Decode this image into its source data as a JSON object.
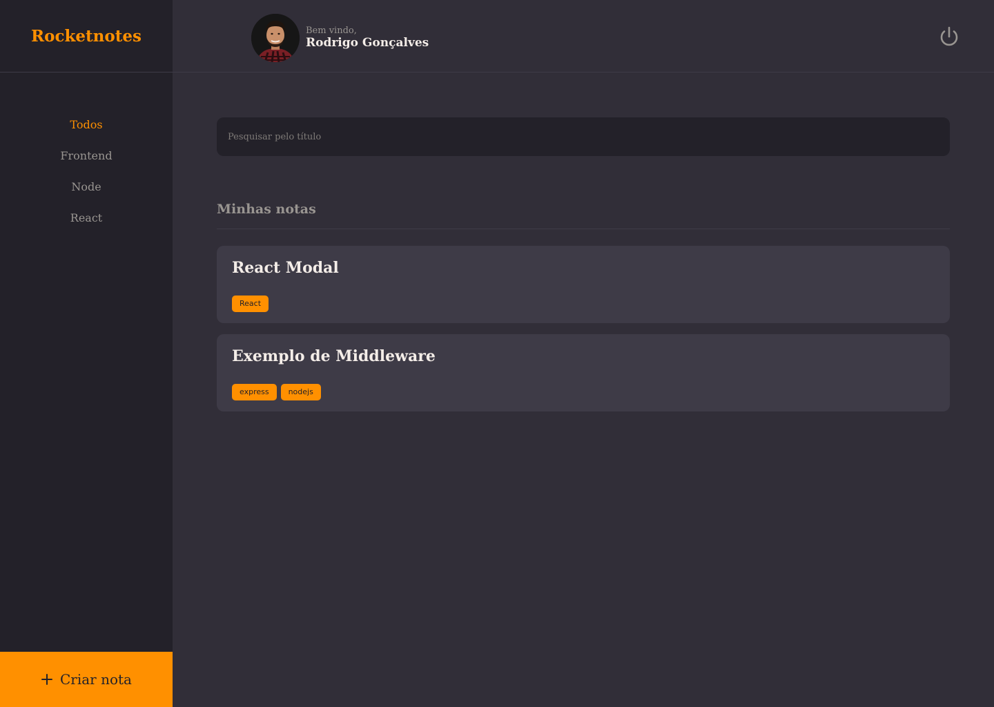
{
  "brand": {
    "title": "Rocketnotes"
  },
  "header": {
    "welcome": "Bem vindo,",
    "user_name": "Rodrigo Gonçalves",
    "logout_icon": "power-icon"
  },
  "menu": {
    "items": [
      {
        "label": "Todos",
        "active": true
      },
      {
        "label": "Frontend",
        "active": false
      },
      {
        "label": "Node",
        "active": false
      },
      {
        "label": "React",
        "active": false
      }
    ]
  },
  "search": {
    "placeholder": "Pesquisar pelo título",
    "value": ""
  },
  "section": {
    "title": "Minhas notas"
  },
  "notes": [
    {
      "title": "React Modal",
      "tags": [
        "React"
      ]
    },
    {
      "title": "Exemplo de Middleware",
      "tags": [
        "express",
        "nodejs"
      ]
    }
  ],
  "new_note": {
    "label": "Criar nota",
    "icon": "plus-icon"
  },
  "colors": {
    "accent": "#FF9000",
    "background": "#312E38",
    "sidebar": "#232129",
    "card": "#3E3B47",
    "text": "#F4EDE8",
    "muted": "#999591"
  }
}
